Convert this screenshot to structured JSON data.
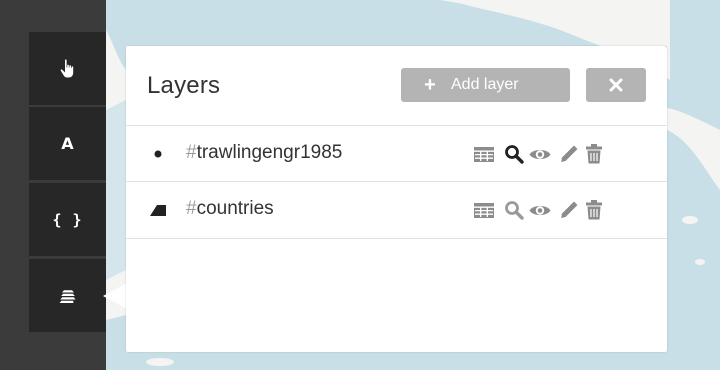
{
  "colors": {
    "sea": "#c9dfe8",
    "land": "#f4f4f2",
    "toolbar_bg": "#3b3b3b",
    "tool_bg": "#272727",
    "panel_bg": "#ffffff",
    "button_bg": "#b4b4b4",
    "icon_active": "#222222",
    "icon_inactive": "#9a9a9a"
  },
  "toolbar": {
    "tools": [
      {
        "icon": "hand-pointer-icon"
      },
      {
        "icon": "text-a-icon",
        "label": "A"
      },
      {
        "icon": "braces-icon",
        "label": "{ }"
      },
      {
        "icon": "layers-icon"
      }
    ]
  },
  "panel": {
    "title": "Layers",
    "add_button": {
      "icon": "plus-icon",
      "plus": "+",
      "label": "Add layer"
    },
    "close_button": {
      "icon": "close-icon"
    },
    "layers": [
      {
        "hash": "#",
        "name": "trawlingengr1985",
        "marker_icon": "point-marker-icon",
        "actions": [
          "table-icon",
          "search-icon",
          "eye-icon",
          "pencil-icon",
          "trash-icon"
        ],
        "search_active": true
      },
      {
        "hash": "#",
        "name": "countries",
        "marker_icon": "polygon-marker-icon",
        "actions": [
          "table-icon",
          "search-icon",
          "eye-icon",
          "pencil-icon",
          "trash-icon"
        ],
        "search_active": false
      }
    ]
  }
}
